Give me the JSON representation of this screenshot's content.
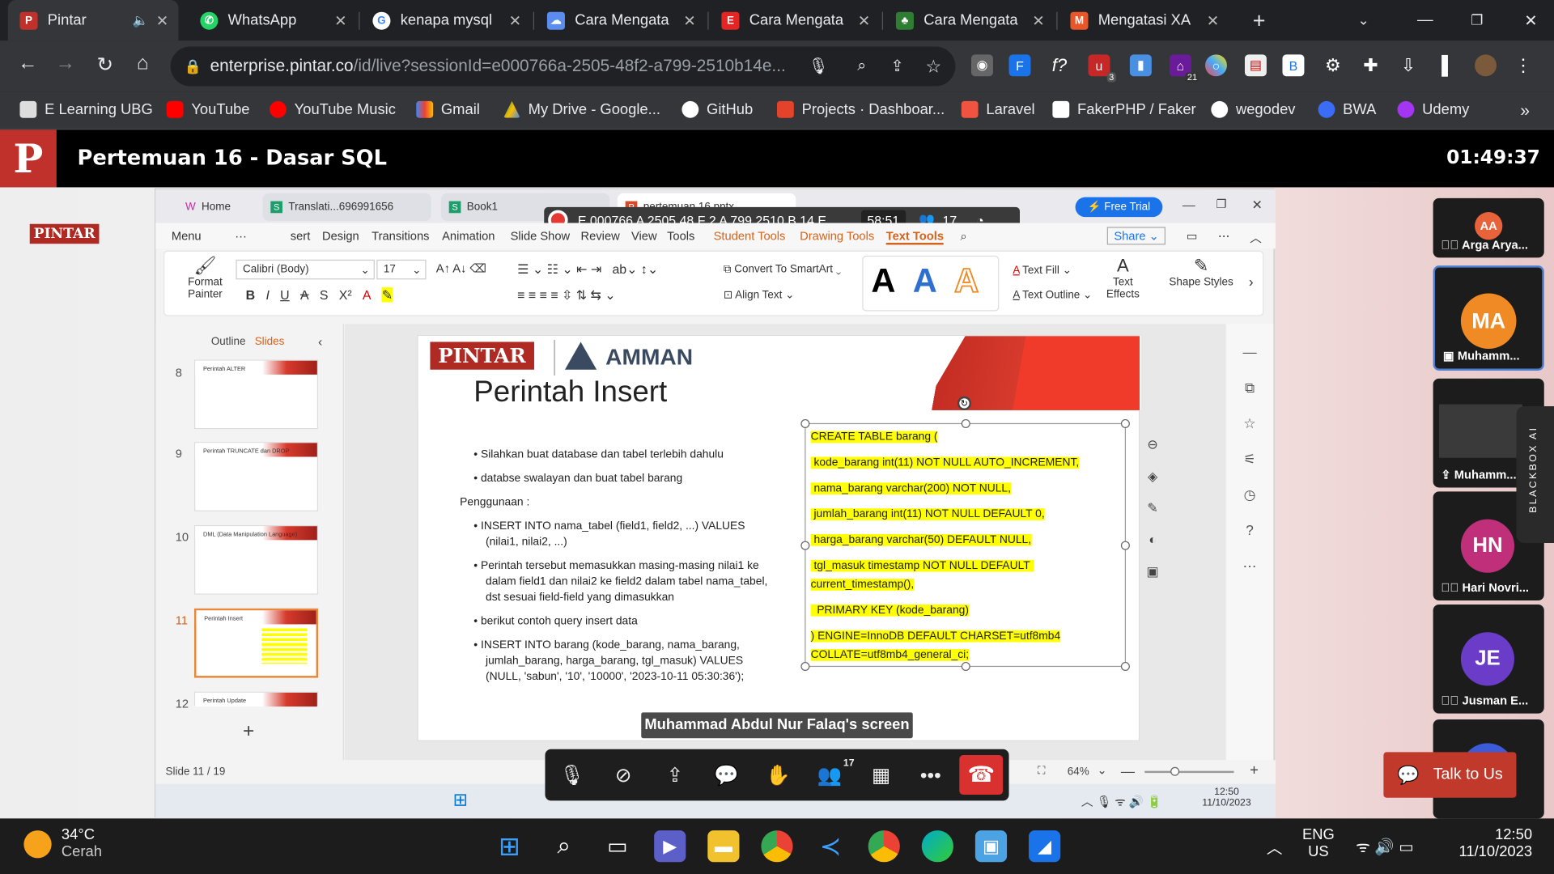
{
  "browser": {
    "tabs": [
      {
        "label": "Pintar",
        "icon": "pintar-icon",
        "active": true
      },
      {
        "label": "WhatsApp",
        "icon": "whatsapp-icon"
      },
      {
        "label": "kenapa mysql",
        "icon": "google-icon"
      },
      {
        "label": "Cara Mengata",
        "icon": "cloud-icon"
      },
      {
        "label": "Cara Mengata",
        "icon": "e-icon"
      },
      {
        "label": "Cara Mengata",
        "icon": "tree-icon"
      },
      {
        "label": "Mengatasi XA",
        "icon": "m-icon"
      }
    ],
    "url_host": "enterprise.pintar.co",
    "url_path": "/id/live?sessionId=e000766a-2505-48f2-a799-2510b14e...",
    "bookmarks": [
      "E Learning UBG",
      "YouTube",
      "YouTube Music",
      "Gmail",
      "My Drive - Google...",
      "GitHub",
      "Projects · Dashboar...",
      "Laravel",
      "FakerPHP / Faker",
      "wegodev",
      "BWA",
      "Udemy"
    ],
    "ext_badges": {
      "ext3": "3",
      "ext21": "21"
    }
  },
  "header": {
    "logo": "P",
    "title": "Pertemuan 16 - Dasar SQL",
    "timer": "01:49:37"
  },
  "badge": "PINTAR",
  "wps": {
    "tabs": [
      "Home",
      "Translati...696991656",
      "Book1",
      "pertemuan 16.pptx"
    ],
    "free_trial": "Free Trial",
    "recording_bar": "E 000766 A 2505 48 F 2 A 799 2510 B 14 E ...",
    "rec_time": "58:51",
    "participants_count": "17",
    "menu": [
      "Menu",
      "sert",
      "Design",
      "Transitions",
      "Animation",
      "Slide Show",
      "Review",
      "View",
      "Tools",
      "Student Tools",
      "Drawing Tools",
      "Text Tools"
    ],
    "share": "Share",
    "ribbon": {
      "format_painter": "Format Painter",
      "font": "Calibri (Body)",
      "size": "17",
      "convert": "Convert To SmartArt",
      "align_text": "Align Text",
      "text_fill": "Text Fill",
      "text_outline": "Text Outline",
      "text_effects": "Text Effects",
      "shape_styles": "Shape Styles"
    },
    "panel_tabs": [
      "Outline",
      "Slides"
    ],
    "thumbs": [
      {
        "num": "8",
        "title": "Perintah ALTER"
      },
      {
        "num": "9",
        "title": "Perintah TRUNCATE dan DROP"
      },
      {
        "num": "10",
        "title": "DML (Data Manipulation Language)"
      },
      {
        "num": "11",
        "title": "Perintah Insert"
      },
      {
        "num": "12",
        "title": "Perintah Update"
      }
    ],
    "status": "Slide 11 / 19",
    "zoom": "64%"
  },
  "slide": {
    "logo_pintar": "PINTAR",
    "logo_amman": "AMMAN",
    "title": "Perintah Insert",
    "bullets": [
      "Silahkan buat database dan tabel terlebih dahulu",
      "databse swalayan dan buat tabel barang"
    ],
    "usage": "Penggunaan :",
    "bullets2": [
      "INSERT INTO nama_tabel (field1, field2, ...) VALUES (nilai1, nilai2, ...)",
      "Perintah tersebut memasukkan masing-masing nilai1 ke dalam field1 dan nilai2 ke field2 dalam tabel nama_tabel, dst sesuai field-field yang dimasukkan",
      "berikut contoh query insert data",
      "INSERT INTO barang (kode_barang, nama_barang, jumlah_barang, harga_barang, tgl_masuk) VALUES (NULL, 'sabun', '10', '10000', '2023-10-11 05:30:36');"
    ],
    "code": [
      "CREATE TABLE barang (",
      " kode_barang int(11) NOT NULL AUTO_INCREMENT,",
      " nama_barang varchar(200) NOT NULL,",
      " jumlah_barang int(11) NOT NULL DEFAULT 0,",
      " harga_barang varchar(50) DEFAULT NULL,",
      " tgl_masuk timestamp NOT NULL DEFAULT current_timestamp(),",
      "  PRIMARY KEY (kode_barang)",
      ") ENGINE=InnoDB DEFAULT CHARSET=utf8mb4 COLLATE=utf8mb4_general_ci;"
    ],
    "highlight_color": "#ffff00"
  },
  "screen_label": "Muhammad Abdul Nur Falaq's screen",
  "controls": {
    "participants": "17"
  },
  "people": [
    {
      "initials": "AA",
      "name": "Arga Arya...",
      "color": "#e8623a"
    },
    {
      "initials": "MA",
      "name": "Muhamm...",
      "color": "#f08a24"
    },
    {
      "initials": "",
      "name": "Muhamm...",
      "color": "#333333"
    },
    {
      "initials": "HN",
      "name": "Hari Novri...",
      "color": "#c0307a"
    },
    {
      "initials": "JE",
      "name": "Jusman E...",
      "color": "#6a3cc8"
    }
  ],
  "talk": "Talk to Us",
  "blackbox": "BLACKBOX AI",
  "inner_taskbar": {
    "time": "12:50",
    "date": "11/10/2023"
  },
  "taskbar": {
    "temp": "34°C",
    "weather": "Cerah",
    "lang1": "ENG",
    "lang2": "US",
    "time": "12:50",
    "date": "11/10/2023"
  }
}
